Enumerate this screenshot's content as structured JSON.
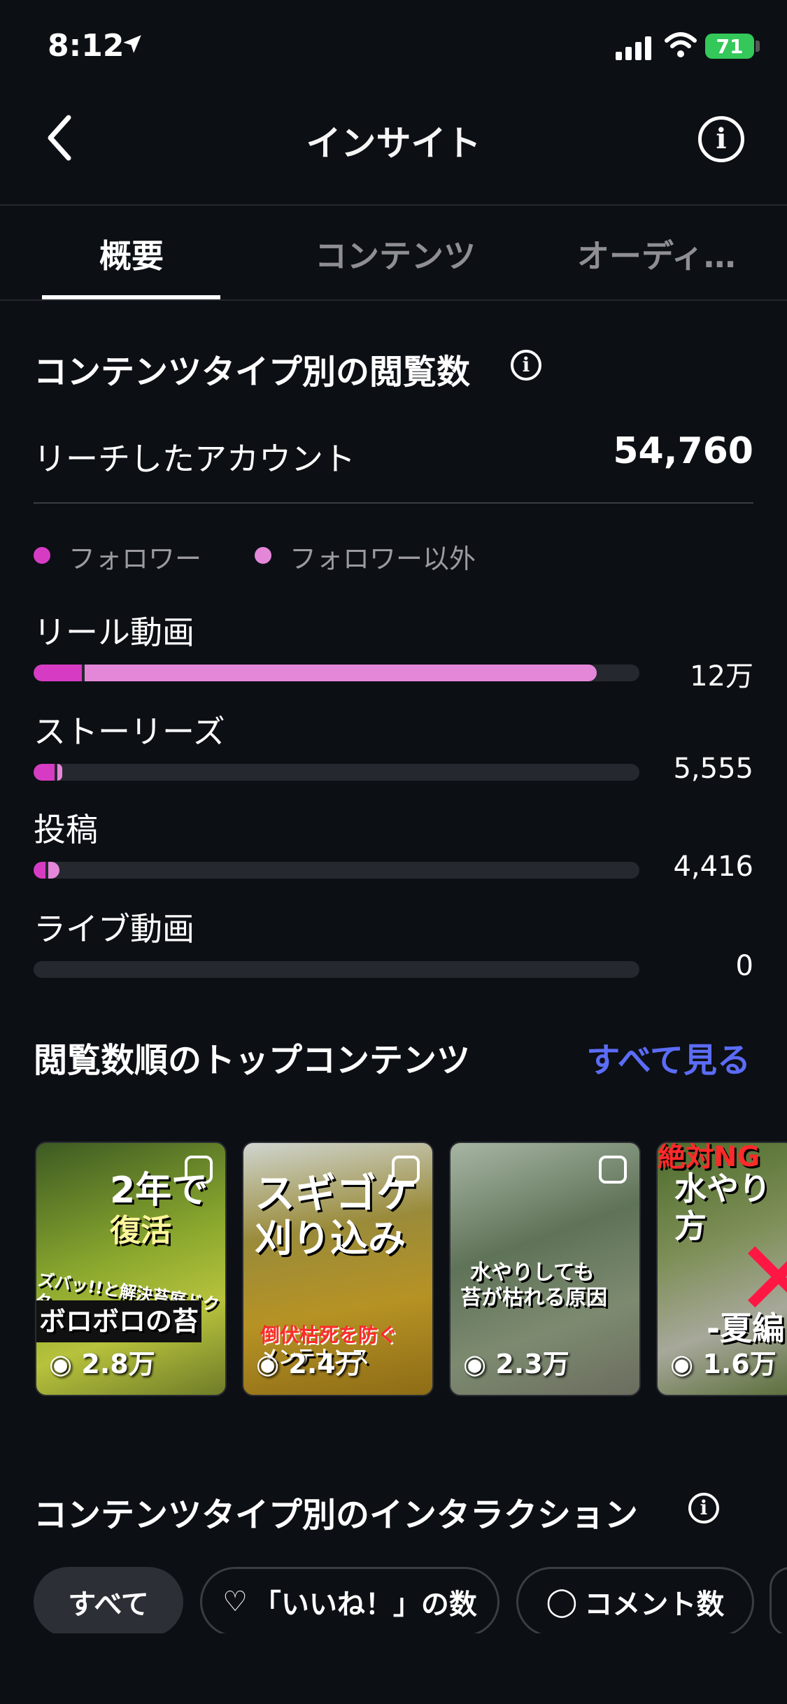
{
  "status": {
    "time": "8:12",
    "battery": "71"
  },
  "header": {
    "title": "インサイト"
  },
  "tabs": [
    {
      "label": "概要"
    },
    {
      "label": "コンテンツ"
    },
    {
      "label": "オーディ…"
    }
  ],
  "views_section": {
    "title": "コンテンツタイプ別の閲覧数",
    "reach_label": "リーチしたアカウント",
    "reach_value": "54,760",
    "legend": [
      {
        "label": "フォロワー",
        "color": "#d63cc3"
      },
      {
        "label": "フォロワー以外",
        "color": "#e487d9"
      }
    ],
    "categories": [
      {
        "label": "リール動画",
        "value": "12万",
        "follower_frac": 0.08,
        "nonfollower_frac": 0.845
      },
      {
        "label": "ストーリーズ",
        "value": "5,555",
        "follower_frac": 0.035,
        "nonfollower_frac": 0.008
      },
      {
        "label": "投稿",
        "value": "4,416",
        "follower_frac": 0.02,
        "nonfollower_frac": 0.018
      },
      {
        "label": "ライブ動画",
        "value": "0",
        "follower_frac": 0,
        "nonfollower_frac": 0
      }
    ]
  },
  "top_content": {
    "title": "閲覧数順のトップコンテンツ",
    "see_all": "すべて見る",
    "items": [
      {
        "caption_top": "2年で",
        "caption_mid": "復活",
        "caption_small": "ズバッ!!と解決苔庭ドクター",
        "caption_bottom": "ボロボロの苔",
        "views": "2.8万"
      },
      {
        "caption_top": "スギゴケ",
        "caption_mid": "刈り込み",
        "caption_small": "倒伏枯死を防ぐ",
        "caption_bottom": "メンテナンス",
        "views": "2.4万"
      },
      {
        "caption_top": "水やりしても",
        "caption_mid": "苔が枯れる原因",
        "views": "2.3万"
      },
      {
        "caption_top": "絶対NG",
        "caption_mid": "水やり方",
        "caption_bottom": "-夏編",
        "views": "1.6万"
      }
    ]
  },
  "interaction_section": {
    "title": "コンテンツタイプ別のインタラクション",
    "chips": [
      {
        "label": "すべて"
      },
      {
        "label": "「いいね！」の数"
      },
      {
        "label": "コメント数"
      }
    ]
  }
}
